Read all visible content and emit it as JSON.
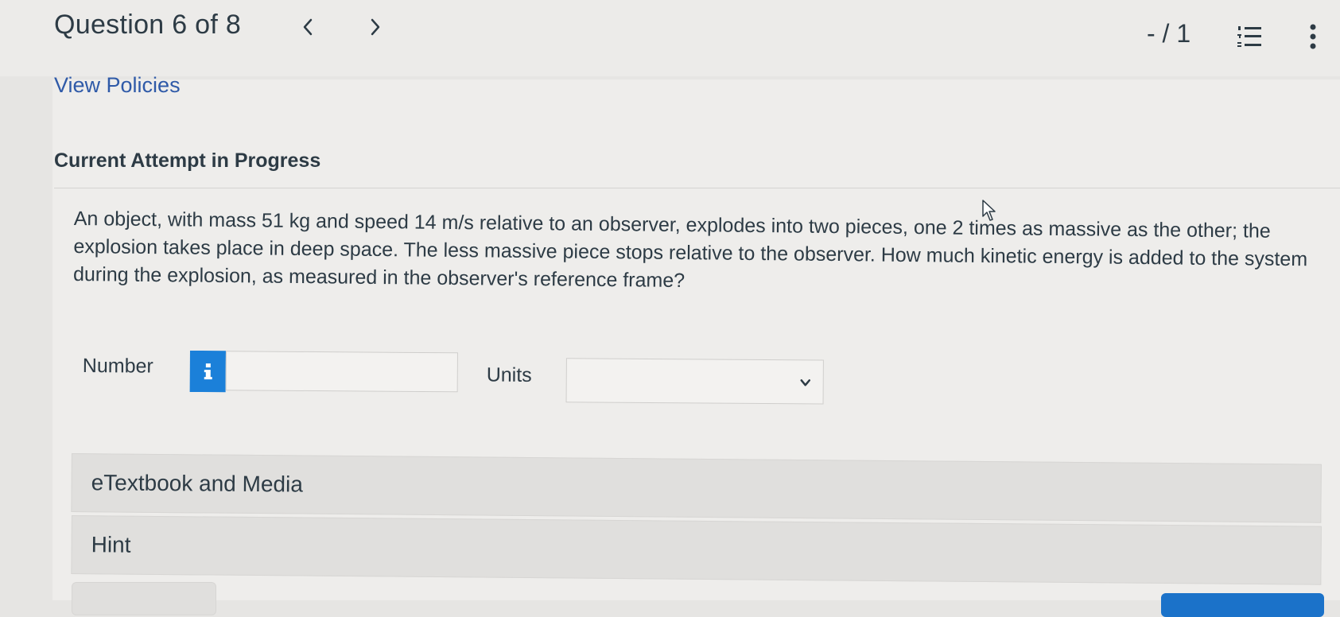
{
  "header": {
    "question_counter": "Question 6 of 8",
    "prev_icon": "chevron-left-icon",
    "next_icon": "chevron-right-icon",
    "score": "- / 1",
    "list_icon": "numbered-list-icon",
    "more_icon": "vertical-ellipsis-icon"
  },
  "links": {
    "view_policies": "View Policies"
  },
  "attempt": {
    "status": "Current Attempt in Progress"
  },
  "question": {
    "text": "An object, with mass 51 kg and speed 14 m/s relative to an observer, explodes into two pieces, one 2 times as massive as the other; the explosion takes place in deep space. The less massive piece stops relative to the observer. How much kinetic energy is added to the system during the explosion, as measured in the observer's reference frame?"
  },
  "answer": {
    "number_label": "Number",
    "number_value": "",
    "info_icon": "info-icon",
    "units_label": "Units",
    "units_selected": "",
    "dropdown_icon": "chevron-down-icon"
  },
  "resources": {
    "etextbook_label": "eTextbook and Media",
    "hint_label": "Hint"
  },
  "colors": {
    "accent_blue": "#1b80d9",
    "link_blue": "#2f5aa8",
    "text": "#2d3b45",
    "background": "#e6e5e3"
  }
}
